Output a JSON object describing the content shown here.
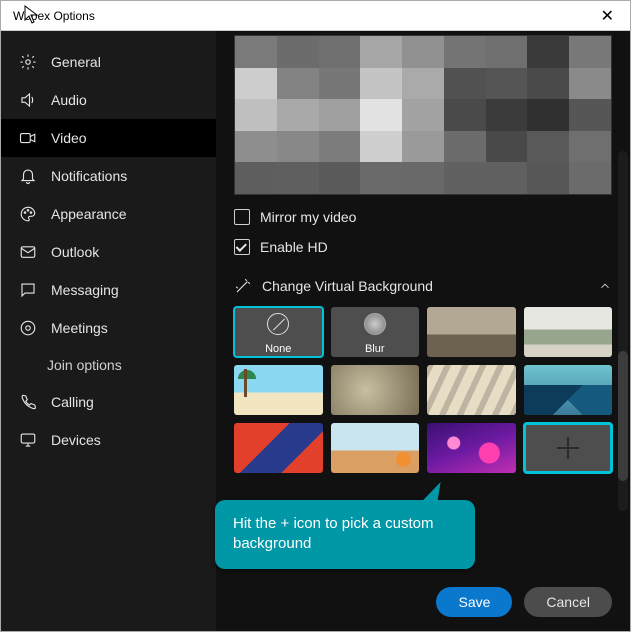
{
  "window": {
    "title": "Webex Options"
  },
  "sidebar": {
    "items": [
      {
        "label": "General"
      },
      {
        "label": "Audio"
      },
      {
        "label": "Video"
      },
      {
        "label": "Notifications"
      },
      {
        "label": "Appearance"
      },
      {
        "label": "Outlook"
      },
      {
        "label": "Messaging"
      },
      {
        "label": "Meetings"
      },
      {
        "label": "Join options"
      },
      {
        "label": "Calling"
      },
      {
        "label": "Devices"
      }
    ],
    "active_index": 2
  },
  "video": {
    "mirror_label": "Mirror my video",
    "mirror_checked": false,
    "hd_label": "Enable HD",
    "hd_checked": true,
    "section_label": "Change Virtual Background",
    "tiles": {
      "none": "None",
      "blur": "Blur"
    }
  },
  "callout": {
    "text": "Hit the + icon to pick a custom background"
  },
  "footer": {
    "save": "Save",
    "cancel": "Cancel"
  }
}
